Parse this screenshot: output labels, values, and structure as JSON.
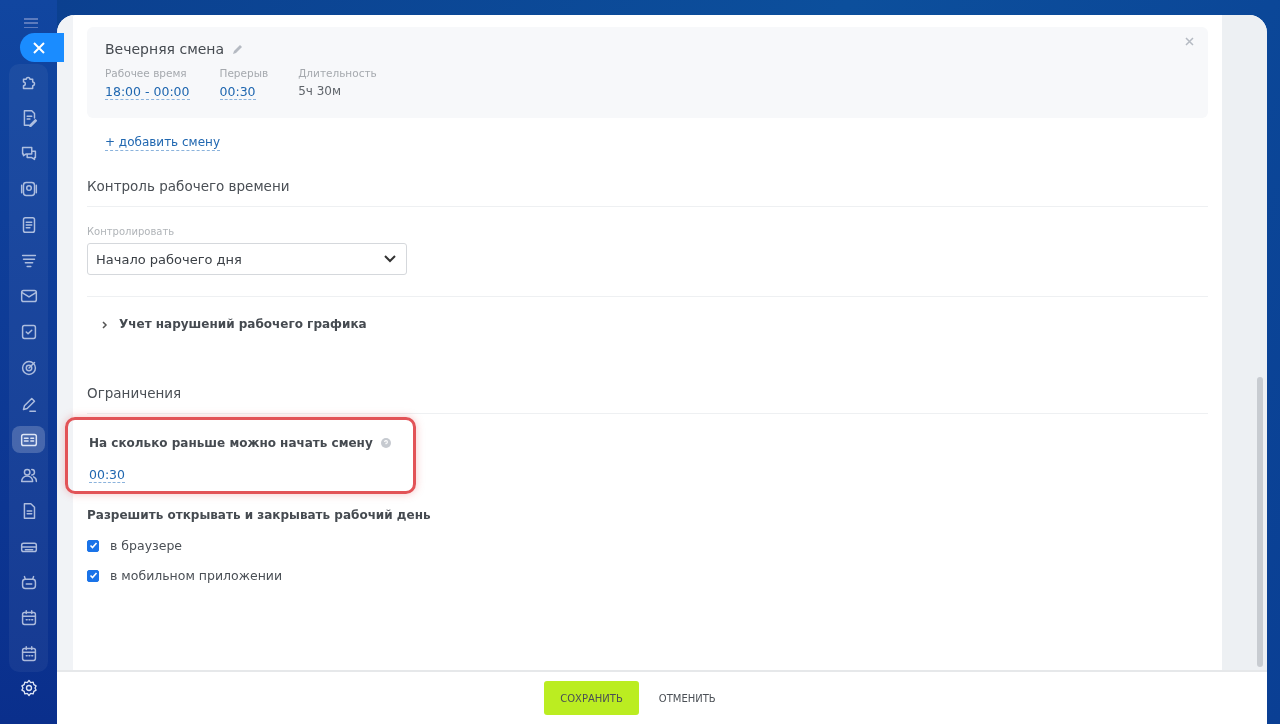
{
  "sidebar": {
    "items": [
      {
        "kind": "puzzle",
        "selected": false
      },
      {
        "kind": "doc-edit",
        "selected": false
      },
      {
        "kind": "chat",
        "selected": false
      },
      {
        "kind": "camera",
        "selected": false
      },
      {
        "kind": "list",
        "selected": false
      },
      {
        "kind": "funnel",
        "selected": false
      },
      {
        "kind": "mail",
        "selected": false
      },
      {
        "kind": "task",
        "selected": false
      },
      {
        "kind": "target",
        "selected": false
      },
      {
        "kind": "pen",
        "selected": false
      },
      {
        "kind": "card",
        "selected": true
      },
      {
        "kind": "people",
        "selected": false
      },
      {
        "kind": "file",
        "selected": false
      },
      {
        "kind": "drive",
        "selected": false
      },
      {
        "kind": "robot",
        "selected": false
      },
      {
        "kind": "calendar",
        "selected": false
      },
      {
        "kind": "calendar",
        "selected": false
      }
    ]
  },
  "shift": {
    "title": "Вечерняя смена",
    "fields": [
      {
        "label": "Рабочее время",
        "value": "18:00 - 00:00",
        "kind": "link"
      },
      {
        "label": "Перерыв",
        "value": "00:30",
        "kind": "link"
      },
      {
        "label": "Длительность",
        "value": "5ч 30м",
        "kind": "text"
      }
    ]
  },
  "add_shift": "+ добавить смену",
  "control": {
    "title": "Контроль рабочего времени",
    "label": "Контролировать",
    "value": "Начало рабочего дня"
  },
  "violations": {
    "label": "Учет нарушений рабочего графика",
    "expanded": false
  },
  "restrictions": {
    "title": "Ограничения",
    "label": "На сколько раньше можно начать смену",
    "value": "00:30",
    "highlighted": true
  },
  "permissions": {
    "title": "Разрешить открывать и закрывать рабочий день",
    "options": [
      {
        "label": "в браузере",
        "checked": true
      },
      {
        "label": "в мобильном приложении",
        "checked": true
      }
    ]
  },
  "buttons": [
    {
      "label": "СОХРАНИТЬ",
      "kind": "primary"
    },
    {
      "label": "ОТМЕНИТЬ",
      "kind": "plain"
    }
  ]
}
